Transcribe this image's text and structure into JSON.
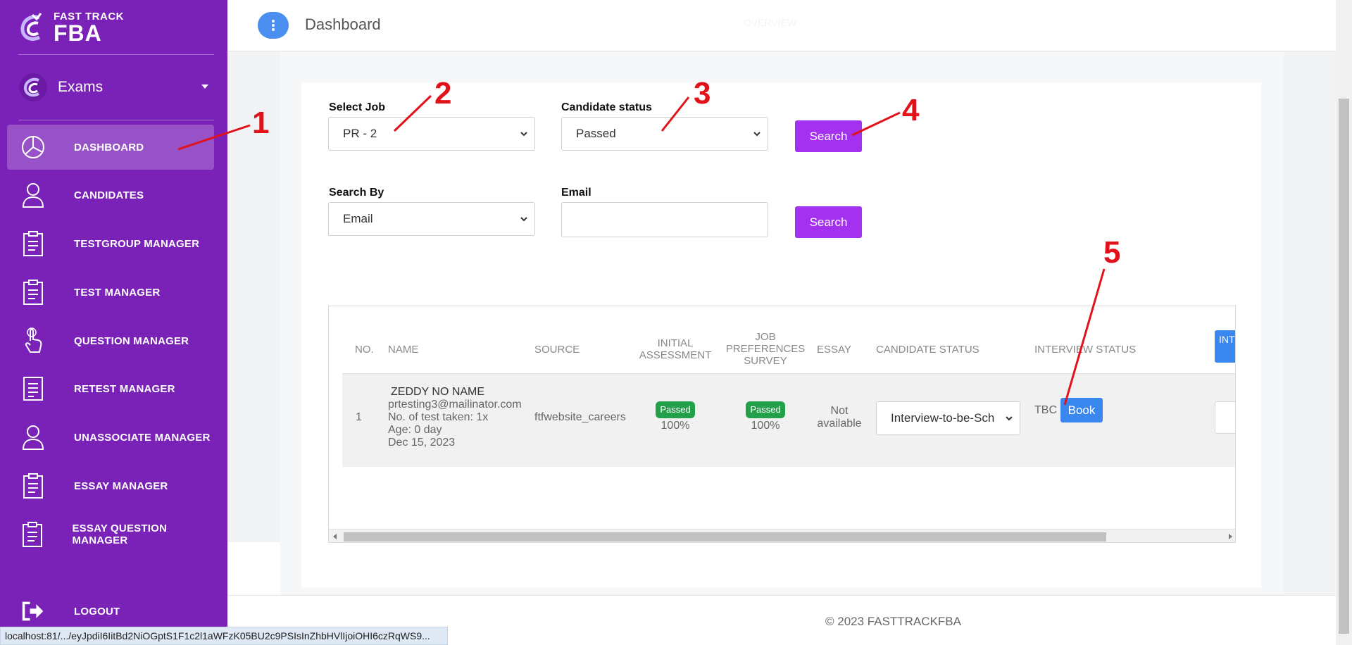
{
  "app": {
    "logo_line1": "FAST TRACK",
    "logo_line2": "FBA",
    "module_selector": "Exams"
  },
  "sidebar": {
    "items": [
      {
        "label": "DASHBOARD",
        "icon": "pie-chart-icon",
        "active": true
      },
      {
        "label": "CANDIDATES",
        "icon": "user-icon"
      },
      {
        "label": "TESTGROUP MANAGER",
        "icon": "clipboard-icon"
      },
      {
        "label": "TEST MANAGER",
        "icon": "clipboard-icon"
      },
      {
        "label": "QUESTION MANAGER",
        "icon": "pointer-hand-icon"
      },
      {
        "label": "RETEST MANAGER",
        "icon": "document-icon"
      },
      {
        "label": "UNASSOCIATE MANAGER",
        "icon": "user-icon"
      },
      {
        "label": "ESSAY MANAGER",
        "icon": "clipboard-icon"
      },
      {
        "label": "ESSAY QUESTION MANAGER",
        "icon": "clipboard-icon"
      }
    ],
    "logout_label": "LOGOUT"
  },
  "header": {
    "title": "Dashboard",
    "overview_label": "OVERVIEW"
  },
  "filters": {
    "select_job_label": "Select Job",
    "select_job_value": "PR - 2",
    "candidate_status_label": "Candidate status",
    "candidate_status_value": "Passed",
    "search_label": "Search",
    "search_by_label": "Search By",
    "search_by_value": "Email",
    "email_label": "Email",
    "email_value": "",
    "search2_label": "Search"
  },
  "table": {
    "headers": {
      "no": "NO.",
      "name": "NAME",
      "source": "SOURCE",
      "initial_assessment_1": "INITIAL",
      "initial_assessment_2": "ASSESSMENT",
      "job_pref_1": "JOB",
      "job_pref_2": "PREFERENCES",
      "job_pref_3": "SURVEY",
      "essay": "ESSAY",
      "candidate_status": "CANDIDATE STATUS",
      "interview_status": "INTERVIEW STATUS",
      "int_button": "INT"
    },
    "rows": [
      {
        "no": "1",
        "name": "ZEDDY NO NAME",
        "email": "prtesting3@mailinator.com",
        "tests_taken": "No. of test taken: 1x",
        "age": "Age: 0 day",
        "date": "Dec 15, 2023",
        "source": "ftfwebsite_careers",
        "initial_assessment_badge": "Passed",
        "initial_assessment_pct": "100%",
        "job_pref_badge": "Passed",
        "job_pref_pct": "100%",
        "essay_1": "Not",
        "essay_2": "available",
        "candidate_status": "Interview-to-be-Sch",
        "interview_status": "TBC",
        "book_label": "Book"
      }
    ]
  },
  "footer": {
    "copyright": "© 2023 FASTTRACKFBA"
  },
  "browser_status": {
    "url": "localhost:81/.../eyJpdiI6IitBd2NiOGptS1F1c2l1aWFzK05BU2c9PSIsInZhbHVlIjoiOHI6czRqWS9..."
  },
  "annotations": [
    "1",
    "2",
    "3",
    "4",
    "5"
  ],
  "colors": {
    "sidebar": "#7a22b8",
    "accent_purple": "#a431f0",
    "accent_blue": "#3b87f0",
    "passed_green": "#22a04a",
    "annotation_red": "#e2121b"
  }
}
